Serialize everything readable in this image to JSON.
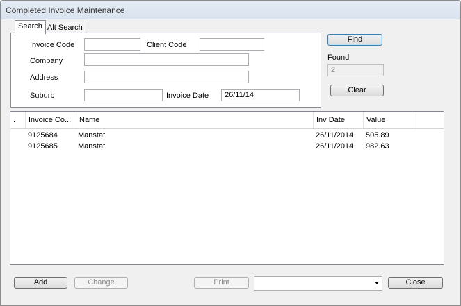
{
  "window": {
    "title": "Completed Invoice Maintenance"
  },
  "tabs": [
    {
      "label": "Search",
      "active": true
    },
    {
      "label": "Alt Search",
      "active": false
    }
  ],
  "search": {
    "invoice_code_label": "Invoice Code",
    "invoice_code_value": "",
    "client_code_label": "Client Code",
    "client_code_value": "",
    "company_label": "Company",
    "company_value": "",
    "address_label": "Address",
    "address_value": "",
    "suburb_label": "Suburb",
    "suburb_value": "",
    "invoice_date_label": "Invoice Date",
    "invoice_date_value": "26/11/14"
  },
  "side": {
    "find_label": "Find",
    "found_label": "Found",
    "found_value": "2",
    "clear_label": "Clear"
  },
  "grid": {
    "columns": [
      ".",
      "Invoice Co...",
      "Name",
      "Inv Date",
      "Value"
    ],
    "rows": [
      {
        "invoice_code": "9125684",
        "name": "Manstat",
        "inv_date": "26/11/2014",
        "value": "505.89"
      },
      {
        "invoice_code": "9125685",
        "name": "Manstat",
        "inv_date": "26/11/2014",
        "value": "982.63"
      }
    ]
  },
  "footer": {
    "add_label": "Add",
    "change_label": "Change",
    "print_label": "Print",
    "print_option": "",
    "close_label": "Close"
  }
}
